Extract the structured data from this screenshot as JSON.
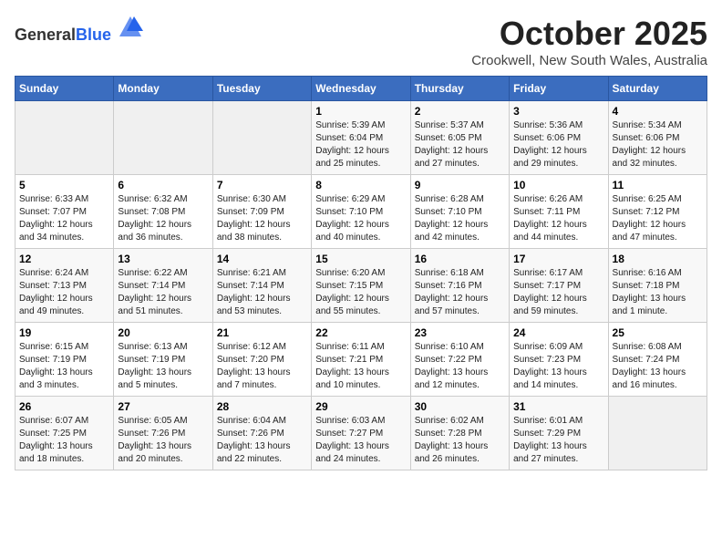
{
  "header": {
    "logo_general": "General",
    "logo_blue": "Blue",
    "month_title": "October 2025",
    "location": "Crookwell, New South Wales, Australia"
  },
  "weekdays": [
    "Sunday",
    "Monday",
    "Tuesday",
    "Wednesday",
    "Thursday",
    "Friday",
    "Saturday"
  ],
  "weeks": [
    [
      {
        "day": "",
        "info": ""
      },
      {
        "day": "",
        "info": ""
      },
      {
        "day": "",
        "info": ""
      },
      {
        "day": "1",
        "info": "Sunrise: 5:39 AM\nSunset: 6:04 PM\nDaylight: 12 hours\nand 25 minutes."
      },
      {
        "day": "2",
        "info": "Sunrise: 5:37 AM\nSunset: 6:05 PM\nDaylight: 12 hours\nand 27 minutes."
      },
      {
        "day": "3",
        "info": "Sunrise: 5:36 AM\nSunset: 6:06 PM\nDaylight: 12 hours\nand 29 minutes."
      },
      {
        "day": "4",
        "info": "Sunrise: 5:34 AM\nSunset: 6:06 PM\nDaylight: 12 hours\nand 32 minutes."
      }
    ],
    [
      {
        "day": "5",
        "info": "Sunrise: 6:33 AM\nSunset: 7:07 PM\nDaylight: 12 hours\nand 34 minutes."
      },
      {
        "day": "6",
        "info": "Sunrise: 6:32 AM\nSunset: 7:08 PM\nDaylight: 12 hours\nand 36 minutes."
      },
      {
        "day": "7",
        "info": "Sunrise: 6:30 AM\nSunset: 7:09 PM\nDaylight: 12 hours\nand 38 minutes."
      },
      {
        "day": "8",
        "info": "Sunrise: 6:29 AM\nSunset: 7:10 PM\nDaylight: 12 hours\nand 40 minutes."
      },
      {
        "day": "9",
        "info": "Sunrise: 6:28 AM\nSunset: 7:10 PM\nDaylight: 12 hours\nand 42 minutes."
      },
      {
        "day": "10",
        "info": "Sunrise: 6:26 AM\nSunset: 7:11 PM\nDaylight: 12 hours\nand 44 minutes."
      },
      {
        "day": "11",
        "info": "Sunrise: 6:25 AM\nSunset: 7:12 PM\nDaylight: 12 hours\nand 47 minutes."
      }
    ],
    [
      {
        "day": "12",
        "info": "Sunrise: 6:24 AM\nSunset: 7:13 PM\nDaylight: 12 hours\nand 49 minutes."
      },
      {
        "day": "13",
        "info": "Sunrise: 6:22 AM\nSunset: 7:14 PM\nDaylight: 12 hours\nand 51 minutes."
      },
      {
        "day": "14",
        "info": "Sunrise: 6:21 AM\nSunset: 7:14 PM\nDaylight: 12 hours\nand 53 minutes."
      },
      {
        "day": "15",
        "info": "Sunrise: 6:20 AM\nSunset: 7:15 PM\nDaylight: 12 hours\nand 55 minutes."
      },
      {
        "day": "16",
        "info": "Sunrise: 6:18 AM\nSunset: 7:16 PM\nDaylight: 12 hours\nand 57 minutes."
      },
      {
        "day": "17",
        "info": "Sunrise: 6:17 AM\nSunset: 7:17 PM\nDaylight: 12 hours\nand 59 minutes."
      },
      {
        "day": "18",
        "info": "Sunrise: 6:16 AM\nSunset: 7:18 PM\nDaylight: 13 hours\nand 1 minute."
      }
    ],
    [
      {
        "day": "19",
        "info": "Sunrise: 6:15 AM\nSunset: 7:19 PM\nDaylight: 13 hours\nand 3 minutes."
      },
      {
        "day": "20",
        "info": "Sunrise: 6:13 AM\nSunset: 7:19 PM\nDaylight: 13 hours\nand 5 minutes."
      },
      {
        "day": "21",
        "info": "Sunrise: 6:12 AM\nSunset: 7:20 PM\nDaylight: 13 hours\nand 7 minutes."
      },
      {
        "day": "22",
        "info": "Sunrise: 6:11 AM\nSunset: 7:21 PM\nDaylight: 13 hours\nand 10 minutes."
      },
      {
        "day": "23",
        "info": "Sunrise: 6:10 AM\nSunset: 7:22 PM\nDaylight: 13 hours\nand 12 minutes."
      },
      {
        "day": "24",
        "info": "Sunrise: 6:09 AM\nSunset: 7:23 PM\nDaylight: 13 hours\nand 14 minutes."
      },
      {
        "day": "25",
        "info": "Sunrise: 6:08 AM\nSunset: 7:24 PM\nDaylight: 13 hours\nand 16 minutes."
      }
    ],
    [
      {
        "day": "26",
        "info": "Sunrise: 6:07 AM\nSunset: 7:25 PM\nDaylight: 13 hours\nand 18 minutes."
      },
      {
        "day": "27",
        "info": "Sunrise: 6:05 AM\nSunset: 7:26 PM\nDaylight: 13 hours\nand 20 minutes."
      },
      {
        "day": "28",
        "info": "Sunrise: 6:04 AM\nSunset: 7:26 PM\nDaylight: 13 hours\nand 22 minutes."
      },
      {
        "day": "29",
        "info": "Sunrise: 6:03 AM\nSunset: 7:27 PM\nDaylight: 13 hours\nand 24 minutes."
      },
      {
        "day": "30",
        "info": "Sunrise: 6:02 AM\nSunset: 7:28 PM\nDaylight: 13 hours\nand 26 minutes."
      },
      {
        "day": "31",
        "info": "Sunrise: 6:01 AM\nSunset: 7:29 PM\nDaylight: 13 hours\nand 27 minutes."
      },
      {
        "day": "",
        "info": ""
      }
    ]
  ]
}
